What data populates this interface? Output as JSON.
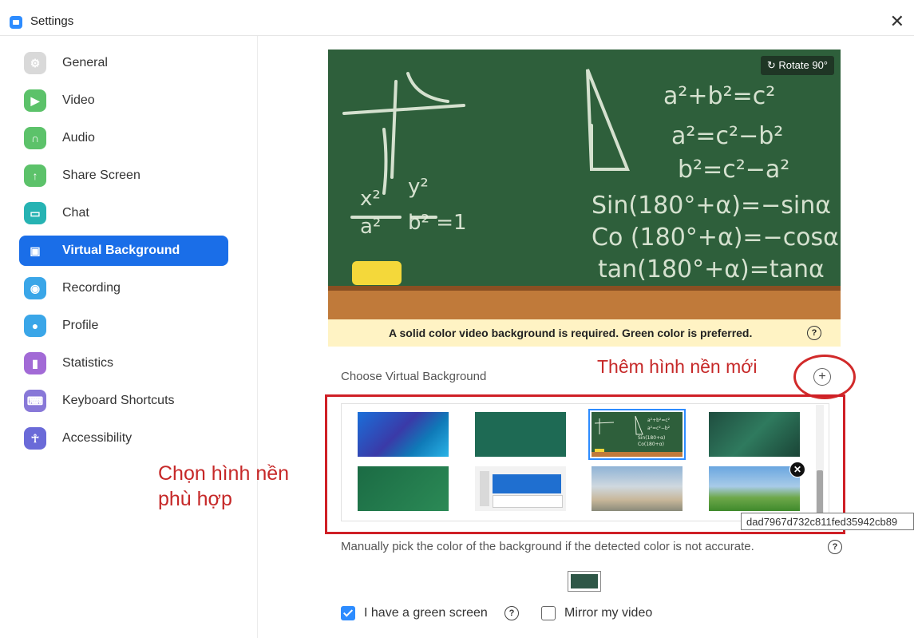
{
  "window": {
    "title": "Settings",
    "close_glyph": "✕",
    "icon": "zoom-logo-icon",
    "accent": "#2d8cff"
  },
  "sidebar": {
    "items": [
      {
        "label": "General",
        "icon": "gear-icon",
        "color": "#d9d9d9",
        "glyph": "⚙"
      },
      {
        "label": "Video",
        "icon": "video-camera-icon",
        "color": "#5cc26a",
        "glyph": "▶"
      },
      {
        "label": "Audio",
        "icon": "headphones-icon",
        "color": "#5cc26a",
        "glyph": "∩"
      },
      {
        "label": "Share Screen",
        "icon": "share-screen-icon",
        "color": "#5cc26a",
        "glyph": "↑"
      },
      {
        "label": "Chat",
        "icon": "chat-bubble-icon",
        "color": "#26b3b3",
        "glyph": "▭"
      },
      {
        "label": "Virtual Background",
        "icon": "person-frame-icon",
        "color": "#1a6ee8",
        "glyph": "▣",
        "active": true
      },
      {
        "label": "Recording",
        "icon": "record-icon",
        "color": "#3aa6e8",
        "glyph": "◉"
      },
      {
        "label": "Profile",
        "icon": "profile-icon",
        "color": "#3aa6e8",
        "glyph": "●"
      },
      {
        "label": "Statistics",
        "icon": "bar-chart-icon",
        "color": "#a26ad6",
        "glyph": "▮"
      },
      {
        "label": "Keyboard Shortcuts",
        "icon": "keyboard-icon",
        "color": "#8878d8",
        "glyph": "⌨"
      },
      {
        "label": "Accessibility",
        "icon": "accessibility-icon",
        "color": "#6a6ad8",
        "glyph": "☥"
      }
    ]
  },
  "preview": {
    "rotate_label": "Rotate 90°",
    "warning": "A solid color video background is required. Green color is preferred.",
    "help_glyph": "?"
  },
  "gallery": {
    "heading": "Choose Virtual Background",
    "add_note": "Thêm hình nền mới",
    "add_glyph": "+",
    "remove_glyph": "✕",
    "tooltip": "dad7967d732c811fed35942cb89",
    "thumbnails": [
      {
        "name": "blue-abstract"
      },
      {
        "name": "green-solid"
      },
      {
        "name": "chalkboard-math",
        "selected": true
      },
      {
        "name": "green-tech"
      },
      {
        "name": "green-doodles"
      },
      {
        "name": "software-screenshot"
      },
      {
        "name": "opera-house"
      },
      {
        "name": "green-field"
      }
    ]
  },
  "annotation_left": "Chọn hình nền phù hợp",
  "manual": {
    "text": "Manually pick the color of the background if the detected color is not accurate.",
    "help_glyph": "?",
    "swatch_color": "#2e5747"
  },
  "options": {
    "green_screen_label": "I have a green screen",
    "green_screen_checked": true,
    "mirror_label": "Mirror my video",
    "mirror_checked": false,
    "help_glyph": "?"
  }
}
